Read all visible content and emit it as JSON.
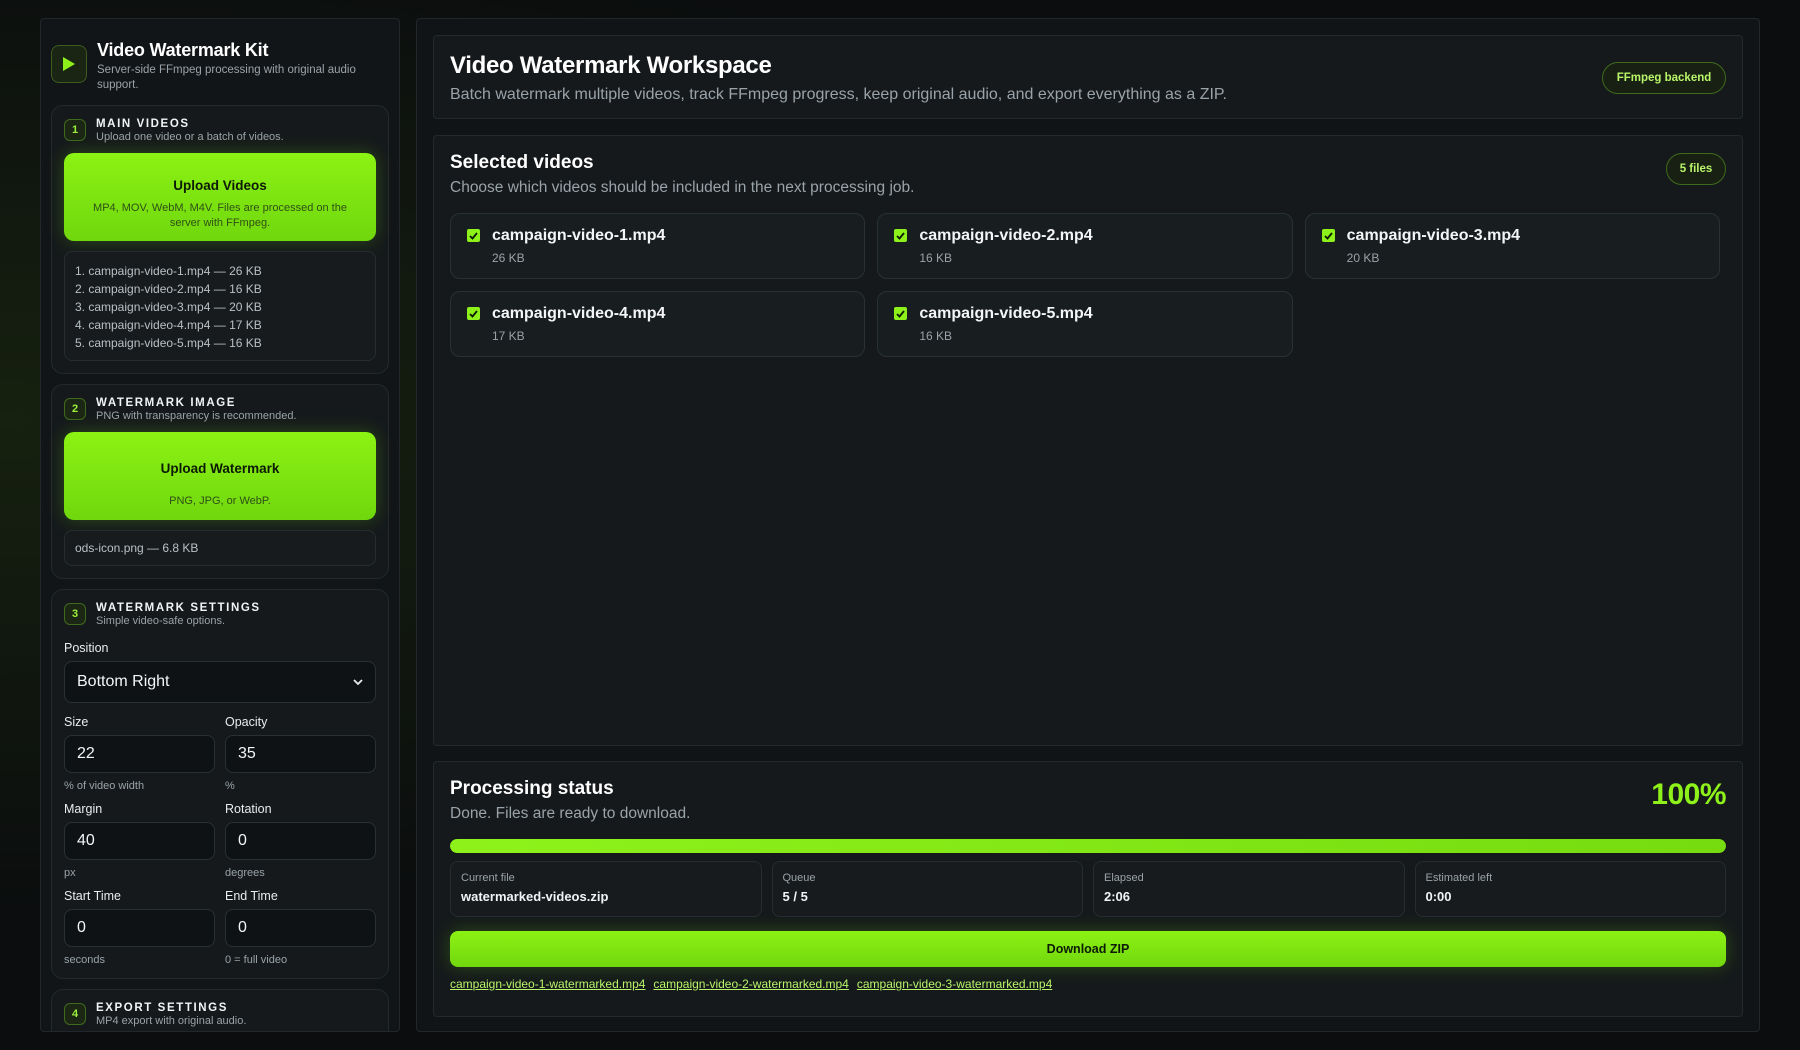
{
  "brand": {
    "title": "Video Watermark Kit",
    "subtitle": "Server-side FFmpeg processing with original audio support."
  },
  "steps": {
    "main_videos": {
      "number": "1",
      "title": "MAIN VIDEOS",
      "subtitle": "Upload one video or a batch of videos.",
      "upload_label": "Upload Videos",
      "upload_hint": "MP4, MOV, WebM, M4V. Files are processed on the server with FFmpeg.",
      "files": [
        "1. campaign-video-1.mp4 — 26 KB",
        "2. campaign-video-2.mp4 — 16 KB",
        "3. campaign-video-3.mp4 — 20 KB",
        "4. campaign-video-4.mp4 — 17 KB",
        "5. campaign-video-5.mp4 — 16 KB"
      ]
    },
    "watermark_image": {
      "number": "2",
      "title": "WATERMARK IMAGE",
      "subtitle": "PNG with transparency is recommended.",
      "upload_label": "Upload Watermark",
      "upload_hint": "PNG, JPG, or WebP.",
      "file": "ods-icon.png — 6.8 KB"
    },
    "settings": {
      "number": "3",
      "title": "WATERMARK SETTINGS",
      "subtitle": "Simple video-safe options.",
      "position_label": "Position",
      "position_value": "Bottom Right",
      "size_label": "Size",
      "size_value": "22",
      "size_hint": "% of video width",
      "opacity_label": "Opacity",
      "opacity_value": "35",
      "opacity_hint": "%",
      "margin_label": "Margin",
      "margin_value": "40",
      "margin_hint": "px",
      "rotation_label": "Rotation",
      "rotation_value": "0",
      "rotation_hint": "degrees",
      "start_label": "Start Time",
      "start_value": "0",
      "start_hint": "seconds",
      "end_label": "End Time",
      "end_value": "0",
      "end_hint": "0 = full video"
    },
    "export": {
      "number": "4",
      "title": "EXPORT SETTINGS",
      "subtitle": "MP4 export with original audio."
    }
  },
  "workspace": {
    "title": "Video Watermark Workspace",
    "subtitle": "Batch watermark multiple videos, track FFmpeg progress, keep original audio, and export everything as a ZIP.",
    "backend_badge": "FFmpeg backend"
  },
  "selected": {
    "title": "Selected videos",
    "subtitle": "Choose which videos should be included in the next processing job.",
    "count_badge": "5 files",
    "videos": [
      {
        "name": "campaign-video-1.mp4",
        "size": "26 KB",
        "checked": true
      },
      {
        "name": "campaign-video-2.mp4",
        "size": "16 KB",
        "checked": true
      },
      {
        "name": "campaign-video-3.mp4",
        "size": "20 KB",
        "checked": true
      },
      {
        "name": "campaign-video-4.mp4",
        "size": "17 KB",
        "checked": true
      },
      {
        "name": "campaign-video-5.mp4",
        "size": "16 KB",
        "checked": true
      }
    ]
  },
  "status": {
    "title": "Processing status",
    "subtitle": "Done. Files are ready to download.",
    "percent_label": "100%",
    "progress": 1.0,
    "stats": [
      {
        "label": "Current file",
        "value": "watermarked-videos.zip"
      },
      {
        "label": "Queue",
        "value": "5 / 5"
      },
      {
        "label": "Elapsed",
        "value": "2:06"
      },
      {
        "label": "Estimated left",
        "value": "0:00"
      }
    ],
    "download_label": "Download ZIP",
    "output_links": [
      "campaign-video-1-watermarked.mp4",
      "campaign-video-2-watermarked.mp4",
      "campaign-video-3-watermarked.mp4"
    ]
  },
  "colors": {
    "accent": "#8ef21a",
    "background": "#0b0d0e",
    "panel": "#15191b"
  },
  "icons": {
    "brand": "play-icon",
    "dropdown": "chevron-down-icon",
    "checkbox": "checkmark-icon"
  }
}
